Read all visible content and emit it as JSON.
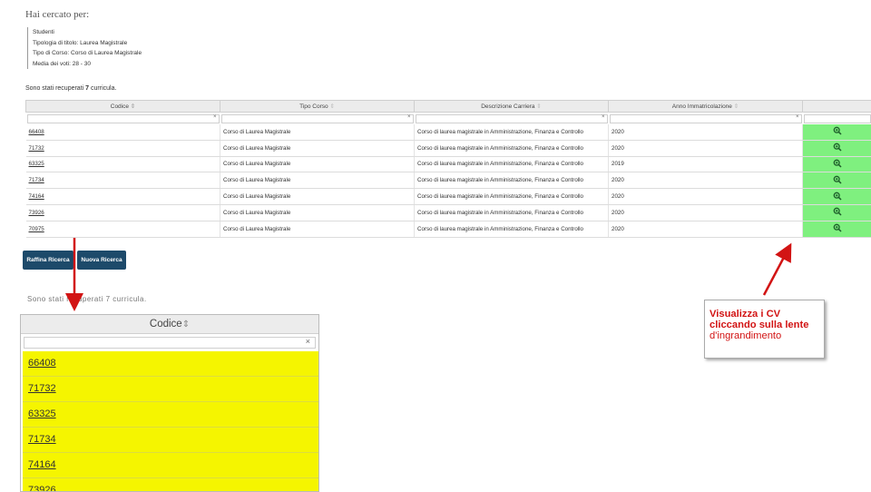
{
  "search": {
    "heading": "Hai cercato per:",
    "criteria": [
      "Studenti",
      "Tipologia di titolo: Laurea Magistrale",
      "Tipo di Corso: Corso di Laurea Magistrale",
      "Media dei voti: 28 - 30"
    ],
    "result_prefix": "Sono stati recuperati",
    "result_count": "7",
    "result_suffix": "curricula."
  },
  "table": {
    "headers": [
      "Codice",
      "Tipo Corso",
      "Descrizione Carriera",
      "Anno Immatricolazione"
    ],
    "sort_icons": [
      "⇕",
      "⇕",
      "⇕",
      "⇕"
    ],
    "clear_symbol": "×",
    "view_icon": "magnifier-icon",
    "rows": [
      {
        "code": "66408",
        "tipo": "Corso di Laurea Magistrale",
        "descrizione": "Corso di laurea magistrale in Amministrazione, Finanza e Controllo",
        "anno": "2020"
      },
      {
        "code": "71732",
        "tipo": "Corso di Laurea Magistrale",
        "descrizione": "Corso di laurea magistrale in Amministrazione, Finanza e Controllo",
        "anno": "2020"
      },
      {
        "code": "63325",
        "tipo": "Corso di Laurea Magistrale",
        "descrizione": "Corso di laurea magistrale in Amministrazione, Finanza e Controllo",
        "anno": "2019"
      },
      {
        "code": "71734",
        "tipo": "Corso di Laurea Magistrale",
        "descrizione": "Corso di laurea magistrale in Amministrazione, Finanza e Controllo",
        "anno": "2020"
      },
      {
        "code": "74164",
        "tipo": "Corso di Laurea Magistrale",
        "descrizione": "Corso di laurea magistrale in Amministrazione, Finanza e Controllo",
        "anno": "2020"
      },
      {
        "code": "73926",
        "tipo": "Corso di Laurea Magistrale",
        "descrizione": "Corso di laurea magistrale in Amministrazione, Finanza e Controllo",
        "anno": "2020"
      },
      {
        "code": "70975",
        "tipo": "Corso di Laurea Magistrale",
        "descrizione": "Corso di laurea magistrale in Amministrazione, Finanza e Controllo",
        "anno": "2020"
      }
    ]
  },
  "buttons": {
    "refine": "Raffina Ricerca",
    "new_search": "Nuova Ricerca"
  },
  "zoom": {
    "faint_text": "Sono stati recuperati 7 curricula.",
    "header": "Codice",
    "sort_icon": "⇕",
    "clear_symbol": "×",
    "codes": [
      "66408",
      "71732",
      "63325",
      "71734",
      "74164",
      "73926"
    ]
  },
  "callout": {
    "line1": "Visualizza i CV",
    "line2": "cliccando sulla lente",
    "line3": "d'ingrandimento"
  },
  "colors": {
    "button_bg": "#1d4a6a",
    "highlight_green": "#7ff07f",
    "highlight_yellow": "#f5f500",
    "annotation_red": "#d21414"
  }
}
